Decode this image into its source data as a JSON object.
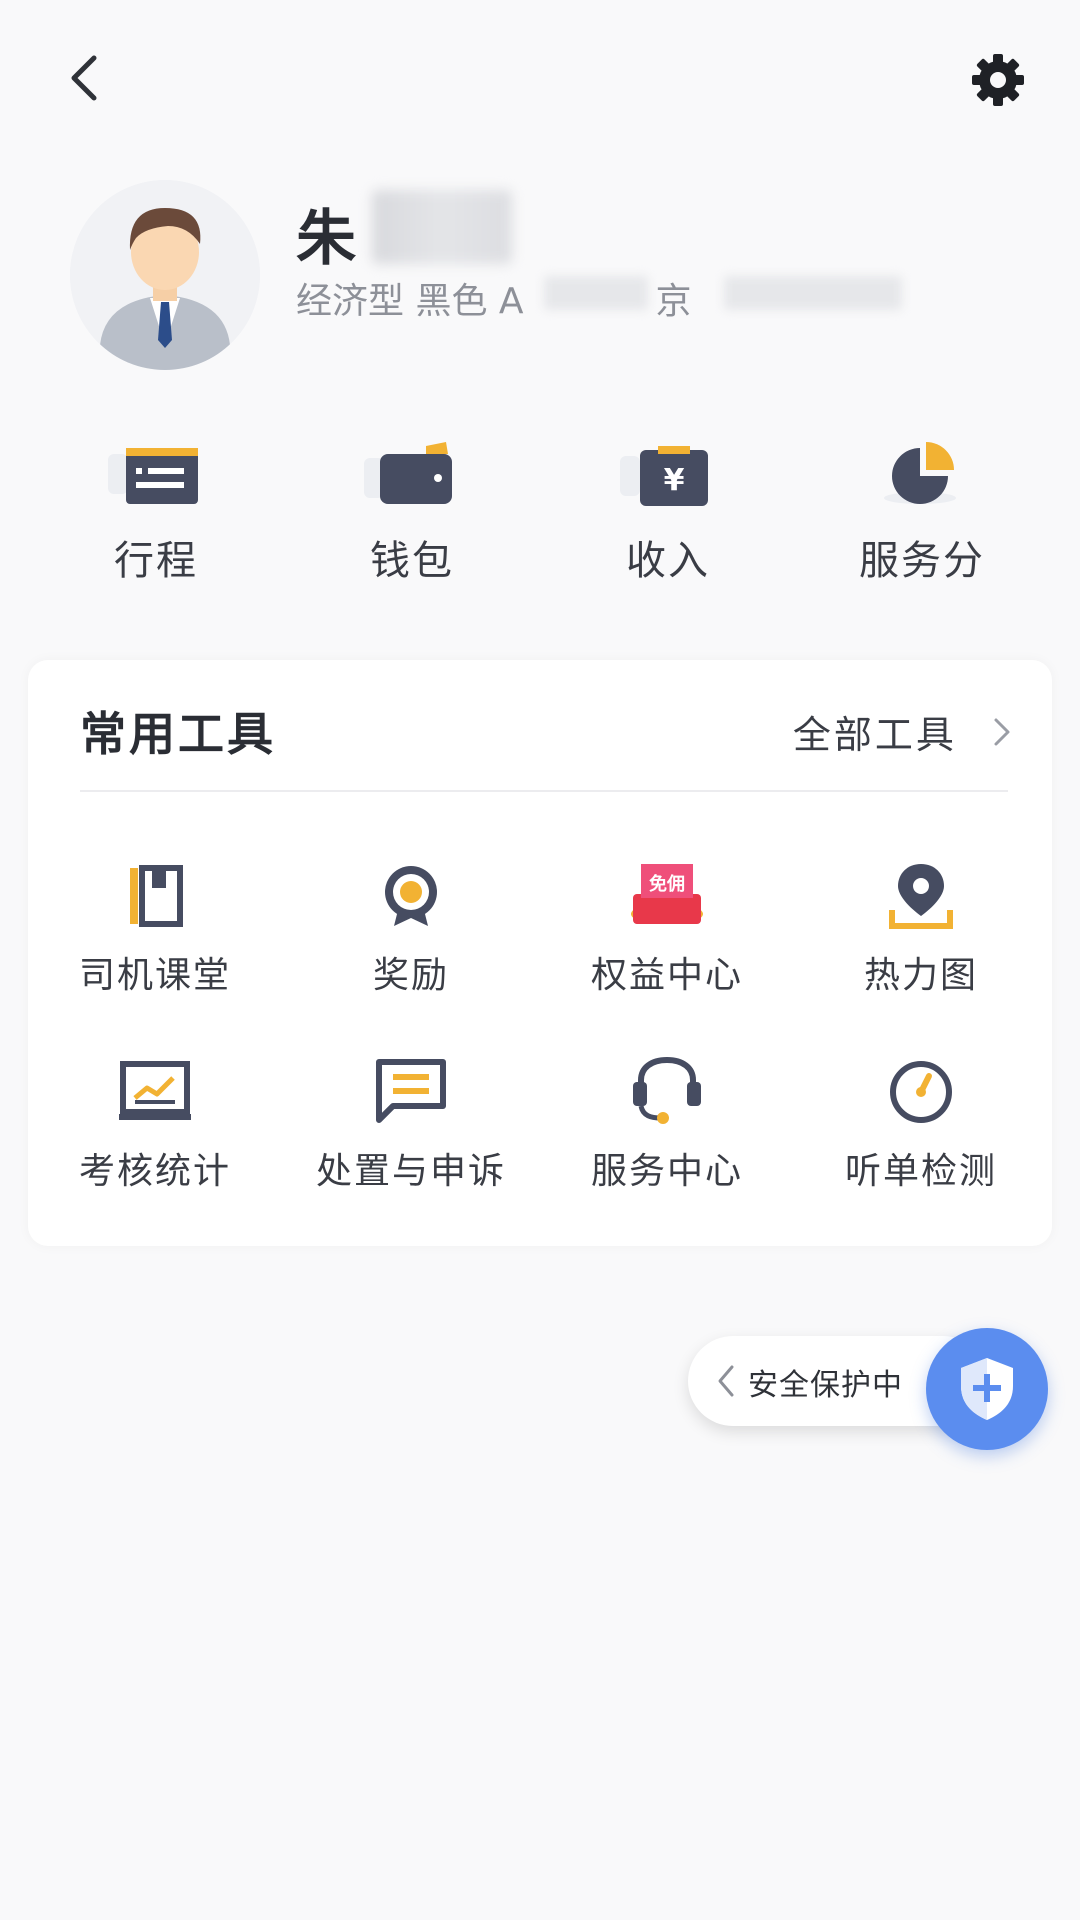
{
  "profile": {
    "name": "朱",
    "car_info": "经济型 黑色 A",
    "plate_prefix": "京"
  },
  "quick_actions": [
    {
      "label": "行程",
      "icon": "trip-card-icon"
    },
    {
      "label": "钱包",
      "icon": "wallet-icon"
    },
    {
      "label": "收入",
      "icon": "income-yen-icon"
    },
    {
      "label": "服务分",
      "icon": "pie-chart-icon"
    }
  ],
  "tools": {
    "title": "常用工具",
    "all_label": "全部工具",
    "items": [
      {
        "label": "司机课堂",
        "icon": "book-icon"
      },
      {
        "label": "奖励",
        "icon": "medal-icon"
      },
      {
        "label": "权益中心",
        "icon": "coupon-gift-icon",
        "badge": "免佣"
      },
      {
        "label": "热力图",
        "icon": "map-pin-icon"
      },
      {
        "label": "考核统计",
        "icon": "chart-board-icon"
      },
      {
        "label": "处置与申诉",
        "icon": "message-icon"
      },
      {
        "label": "服务中心",
        "icon": "headset-icon"
      },
      {
        "label": "听单检测",
        "icon": "gauge-icon"
      }
    ]
  },
  "safety": {
    "label": "安全保护中"
  },
  "colors": {
    "accent": "#f2b233",
    "icon_dark": "#464c61",
    "shield_blue": "#5b8def"
  }
}
